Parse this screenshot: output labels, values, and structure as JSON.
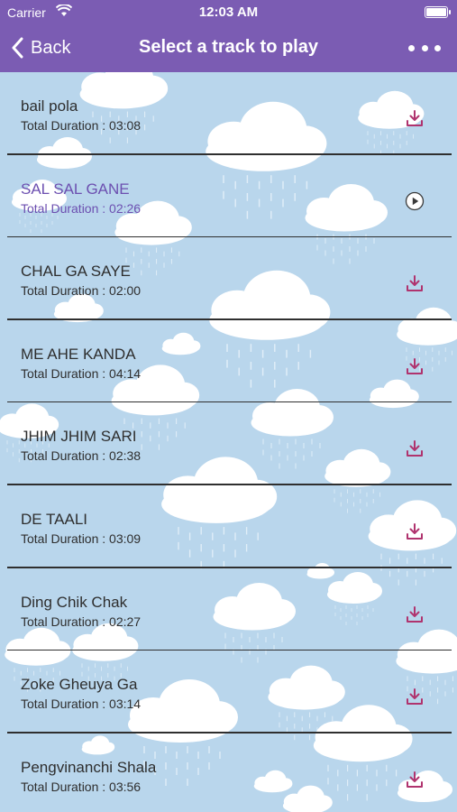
{
  "status_bar": {
    "carrier": "Carrier",
    "time": "12:03 AM"
  },
  "nav": {
    "back_label": "Back",
    "title": "Select a track to play"
  },
  "colors": {
    "header": "#7b5cb3",
    "background": "#b9d6ec",
    "download_icon": "#b0336e",
    "active_track": "#6c4fb0"
  },
  "tracks": [
    {
      "title": "bail pola",
      "duration": "Total Duration : 03:08",
      "action": "download-icon"
    },
    {
      "title": "SAL SAL GANE",
      "duration": "Total Duration : 02:26",
      "action": "play-icon",
      "active": true
    },
    {
      "title": "CHAL GA SAYE",
      "duration": "Total Duration : 02:00",
      "action": "download-icon"
    },
    {
      "title": "ME AHE KANDA",
      "duration": "Total Duration : 04:14",
      "action": "download-icon"
    },
    {
      "title": "JHIM JHIM SARI",
      "duration": "Total Duration : 02:38",
      "action": "download-icon"
    },
    {
      "title": "DE TAALI",
      "duration": "Total Duration : 03:09",
      "action": "download-icon"
    },
    {
      "title": "Ding Chik Chak",
      "duration": "Total Duration : 02:27",
      "action": "download-icon"
    },
    {
      "title": "Zoke Gheuya Ga",
      "duration": "Total Duration : 03:14",
      "action": "download-icon"
    },
    {
      "title": "Pengvinanchi Shala",
      "duration": "Total Duration : 03:56",
      "action": "download-icon"
    }
  ]
}
